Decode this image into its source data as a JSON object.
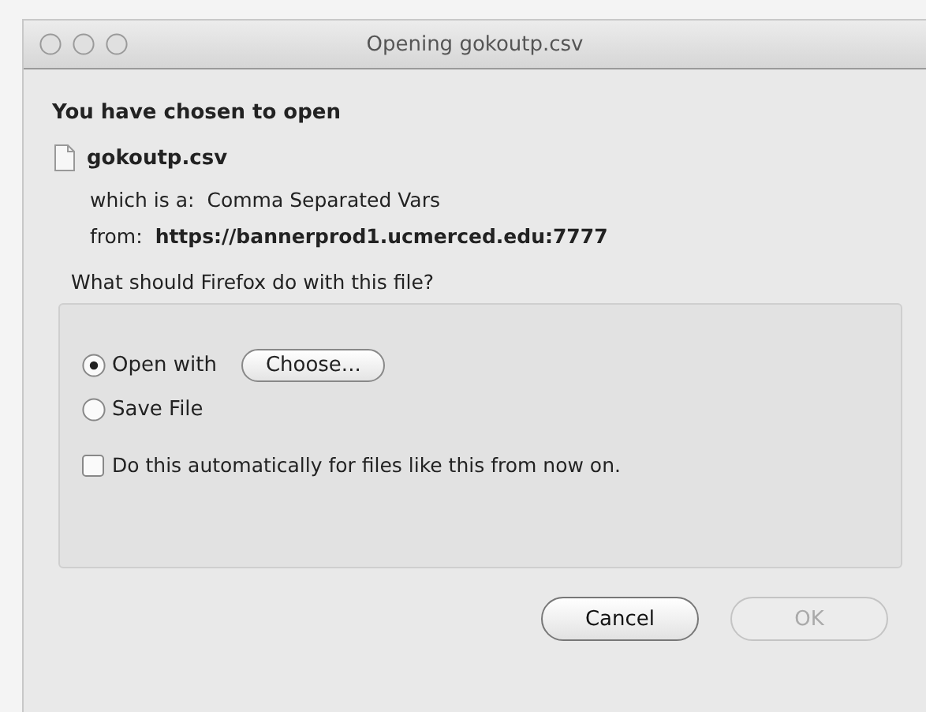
{
  "window": {
    "title": "Opening gokoutp.csv"
  },
  "heading": "You have chosen to open",
  "file": {
    "name": "gokoutp.csv",
    "type_label": "which is a:",
    "type_value": "Comma Separated Vars",
    "from_label": "from:",
    "from_value": "https://bannerprod1.ucmerced.edu:7777"
  },
  "question": "What should Firefox do with this file?",
  "options": [
    {
      "label": "Open with",
      "selected": true
    },
    {
      "label": "Save File",
      "selected": false
    }
  ],
  "choose_button": "Choose...",
  "auto_checkbox": {
    "label": "Do this automatically for files like this from now on.",
    "checked": false
  },
  "buttons": [
    {
      "label": "Cancel",
      "disabled": false
    },
    {
      "label": "OK",
      "disabled": true
    }
  ]
}
